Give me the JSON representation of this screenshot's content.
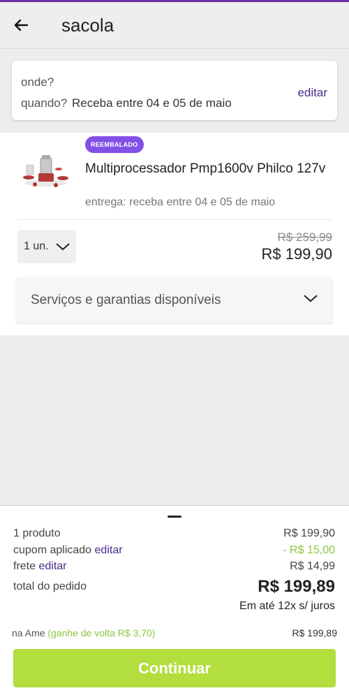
{
  "header": {
    "title": "sacola",
    "back_icon": "arrow-left-icon"
  },
  "delivery": {
    "where_label": "onde?",
    "when_label": "quandо?",
    "when_value": "Receba entre 04 e 05 de maio",
    "edit_label": "editar"
  },
  "product": {
    "badge": "REEMBALADO",
    "name": "Multiprocessador Pmp1600v Philco 127v",
    "delivery": "entrega: receba entre 04 e 05 de maio",
    "quantity": "1 un.",
    "price_old": "R$ 259,99",
    "price_new": "R$ 199,90"
  },
  "services": {
    "label": "Serviços e garantias disponíveis"
  },
  "summary": {
    "products_label": "1 produto",
    "products_value": "R$ 199,90",
    "coupon_label": "cupom aplicado",
    "coupon_edit": "editar",
    "coupon_value": "- R$ 15,00",
    "shipping_label": "frete",
    "shipping_edit": "editar",
    "shipping_value": "R$ 14,99",
    "total_label": "total do pedido",
    "total_value": "R$ 199,89",
    "installments": "Em até 12x s/ juros",
    "ame_label": "na Ame",
    "ame_cashback": "(ganhe de volta R$ 3,70)",
    "ame_price": "R$ 199,89"
  },
  "actions": {
    "continue_label": "Continuar"
  },
  "colors": {
    "accent": "#4a2a8c",
    "badge": "#8250e6",
    "cta": "#b2de3e",
    "discount": "#8cc63f"
  }
}
